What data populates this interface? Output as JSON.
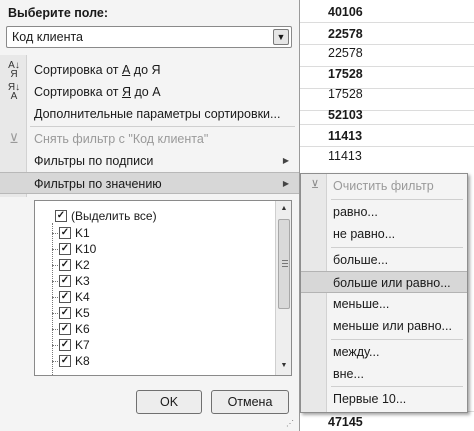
{
  "sheet": {
    "values": [
      {
        "text": "40106",
        "bold": true
      },
      {
        "text": "22578",
        "bold": true
      },
      {
        "text": "22578",
        "bold": false
      },
      {
        "text": "17528",
        "bold": true
      },
      {
        "text": "17528",
        "bold": false
      },
      {
        "text": "52103",
        "bold": true
      },
      {
        "text": "11413",
        "bold": true
      },
      {
        "text": "11413",
        "bold": false
      }
    ],
    "bottom_value": "47145"
  },
  "filter_menu": {
    "field_label": "Выберите поле:",
    "field_value": "Код клиента",
    "sort_az": {
      "pre": "Сортировка от ",
      "a": "А",
      "mid": " до ",
      "b": "Я"
    },
    "sort_za": {
      "pre": "Сортировка от ",
      "a": "Я",
      "mid": " до ",
      "b": "А"
    },
    "more_sort": "Дополнительные параметры сортировки...",
    "clear_filter": "Снять фильтр с \"Код клиента\"",
    "label_filters": "Фильтры по подписи",
    "value_filters": "Фильтры по значению",
    "checklist": [
      {
        "label": "(Выделить все)",
        "checked": true
      },
      {
        "label": "K1",
        "checked": true
      },
      {
        "label": "K10",
        "checked": true
      },
      {
        "label": "K2",
        "checked": true
      },
      {
        "label": "K3",
        "checked": true
      },
      {
        "label": "K4",
        "checked": true
      },
      {
        "label": "K5",
        "checked": true
      },
      {
        "label": "K6",
        "checked": true
      },
      {
        "label": "K7",
        "checked": true
      },
      {
        "label": "K8",
        "checked": true
      }
    ],
    "ok": "OK",
    "cancel": "Отмена"
  },
  "submenu": {
    "clear_filter": "Очистить фильтр",
    "items": [
      {
        "text": "равно...",
        "highlight": false
      },
      {
        "text": "не равно...",
        "highlight": false
      },
      {
        "text": "больше...",
        "highlight": false
      },
      {
        "text": "больше или равно...",
        "highlight": true
      },
      {
        "text": "меньше...",
        "highlight": false
      },
      {
        "text": "меньше или равно...",
        "highlight": false
      },
      {
        "text": "между...",
        "highlight": false
      },
      {
        "text": "вне...",
        "highlight": false
      },
      {
        "text": "Первые 10...",
        "highlight": false
      }
    ]
  },
  "colors": {
    "highlight": "#d7d7d7",
    "menu_bg": "#f4f4f4",
    "disabled_text": "#9a9a9a"
  },
  "icons": [
    "sort-az-icon",
    "sort-za-icon",
    "clear-filter-icon",
    "submenu-arrow-icon",
    "dropdown-arrow-icon",
    "checkbox-icon"
  ]
}
